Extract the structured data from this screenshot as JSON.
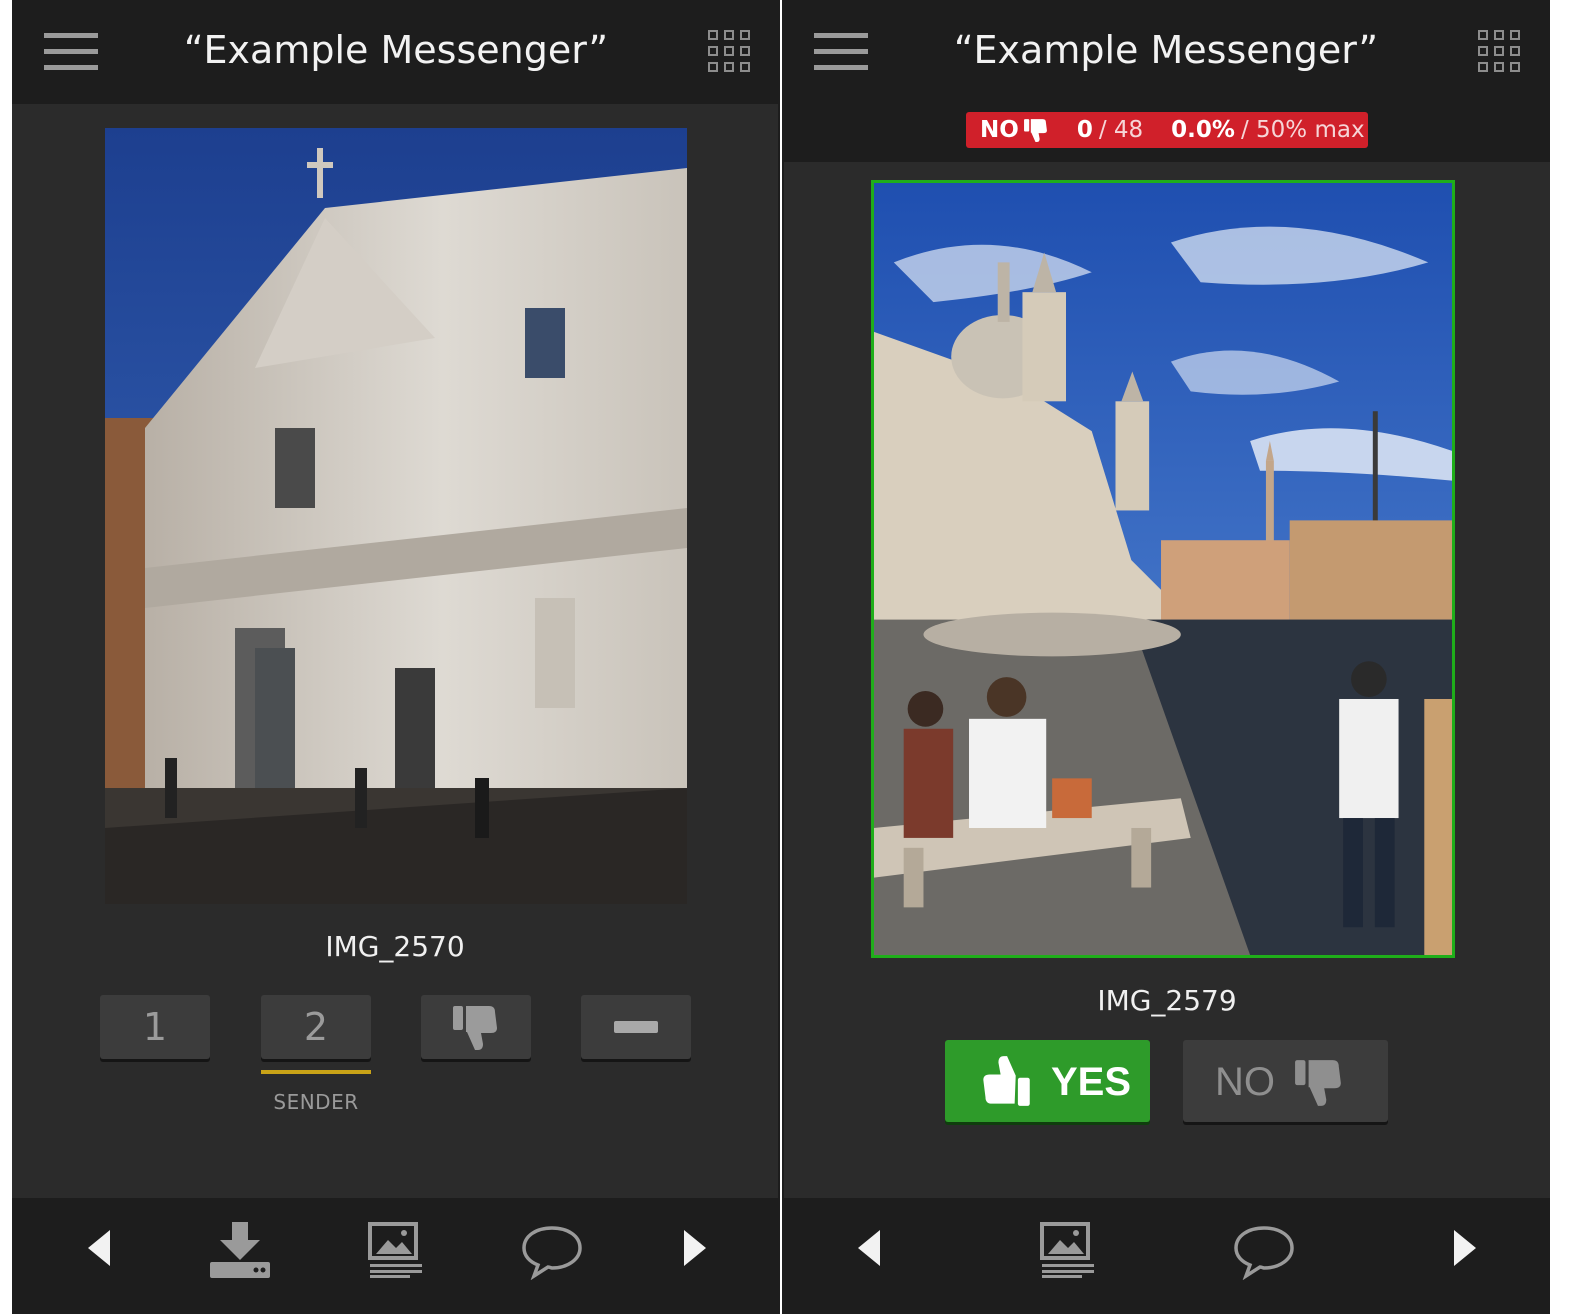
{
  "left_screen": {
    "header": {
      "title": "“Example Messenger”"
    },
    "photo": {
      "filename": "IMG_2570"
    },
    "rating_buttons": [
      {
        "label": "1"
      },
      {
        "label": "2",
        "selected": true,
        "caption": "SENDER"
      }
    ],
    "footer_icons": [
      "arrow-left-icon",
      "download-icon",
      "gallery-icon",
      "chat-bubble-icon",
      "arrow-right-icon"
    ]
  },
  "right_screen": {
    "header": {
      "title": "“Example Messenger”"
    },
    "stats_badge": {
      "vote": "NO",
      "count": "0",
      "total": "/ 48",
      "percent": "0.0%",
      "max": "/ 50% max",
      "color": "#d0202a"
    },
    "photo": {
      "filename": "IMG_2579",
      "border_color": "#1fae1a"
    },
    "yes_label": "YES",
    "no_label": "NO",
    "footer_icons": [
      "arrow-left-icon",
      "gallery-icon",
      "chat-bubble-icon",
      "arrow-right-icon"
    ]
  },
  "colors": {
    "accent_gold": "#c9a317",
    "yes_green": "#2e9b2a",
    "panel": "#2b2b2b",
    "background": "#1d1d1d"
  }
}
